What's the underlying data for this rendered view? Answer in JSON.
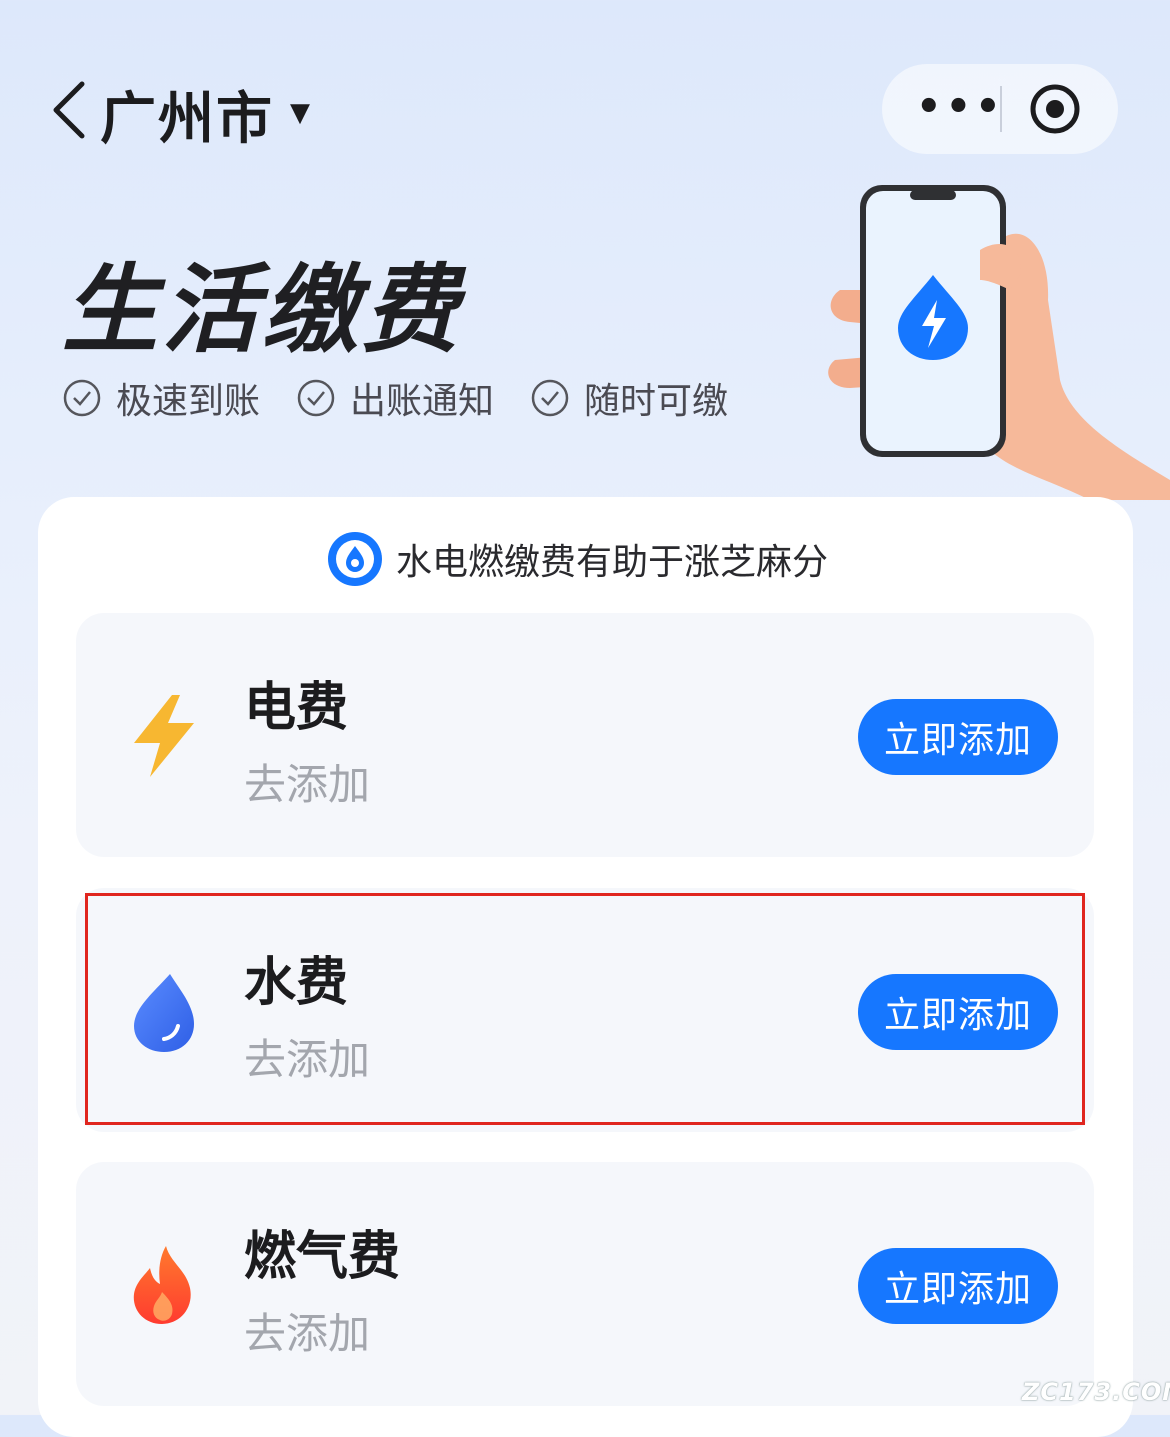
{
  "nav": {
    "city": "广州市",
    "more_label": "•••"
  },
  "hero": {
    "title": "生活缴费",
    "features": [
      "极速到账",
      "出账通知",
      "随时可缴"
    ]
  },
  "promo": {
    "text": "水电燃缴费有助于涨芝麻分"
  },
  "bills": [
    {
      "title": "电费",
      "subtitle": "去添加",
      "button": "立即添加",
      "icon": "lightning-icon",
      "color": "#f7b731"
    },
    {
      "title": "水费",
      "subtitle": "去添加",
      "button": "立即添加",
      "icon": "water-drop-icon",
      "color": "#3b6cf0"
    },
    {
      "title": "燃气费",
      "subtitle": "去添加",
      "button": "立即添加",
      "icon": "flame-icon",
      "color": "#ff5a2c"
    }
  ],
  "colors": {
    "primary": "#1677ff",
    "highlight": "#e0261f"
  },
  "watermark": "ZC173.COM"
}
